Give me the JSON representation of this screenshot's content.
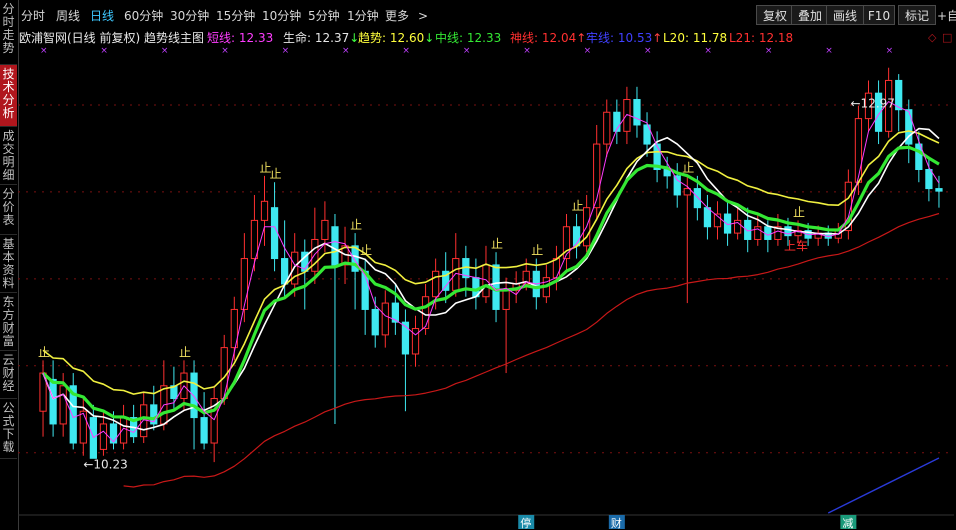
{
  "sidebar": {
    "tabs": [
      {
        "label": "分时走势",
        "active": false
      },
      {
        "label": "技术分析",
        "active": true
      },
      {
        "label": "成交明细",
        "active": false
      },
      {
        "label": "分价表",
        "active": false
      },
      {
        "label": "基本资料",
        "active": false
      },
      {
        "label": "东方财富",
        "active": false
      },
      {
        "label": "云财经",
        "active": false
      },
      {
        "label": "公式下载",
        "active": false
      }
    ]
  },
  "toolbar": {
    "periods": [
      "分时",
      "周线",
      "日线",
      "60分钟",
      "30分钟",
      "15分钟",
      "10分钟",
      "5分钟",
      "1分钟",
      "更多"
    ],
    "active_period": "日线",
    "more_arrow": ">",
    "buttons": [
      "复权",
      "叠加",
      "画线",
      "F10",
      "标记"
    ],
    "add_label": "+自"
  },
  "legend": {
    "title": "欧浦智网(日线 前复权) 趋势线主图",
    "items": [
      {
        "label": "短线: 12.33",
        "arrow": "",
        "color": "#ff3cff"
      },
      {
        "label": "生命: 12.37",
        "arrow": "↓",
        "color": "#e6e6e6"
      },
      {
        "label": "趋势: 12.60",
        "arrow": "↓",
        "color": "#ffff3c"
      },
      {
        "label": "中线: 12.33",
        "arrow": "",
        "color": "#34e834"
      },
      {
        "label": "神线: 12.04",
        "arrow": "↑",
        "color": "#ff3030"
      },
      {
        "label": "牢线: 10.53",
        "arrow": "↑",
        "color": "#4040ff"
      },
      {
        "label": "L20: 11.78",
        "arrow": "",
        "color": "#ffff3c"
      },
      {
        "label": "L21: 12.18",
        "arrow": "",
        "color": "#ff3030"
      }
    ]
  },
  "chart_data": {
    "type": "candlestick",
    "count": 90,
    "ylim": [
      9.8,
      13.4
    ],
    "candles": [
      [
        10.6,
        10.9,
        11.0,
        10.4
      ],
      [
        10.85,
        10.5,
        11.0,
        10.4
      ],
      [
        10.5,
        10.8,
        10.9,
        10.4
      ],
      [
        10.8,
        10.35,
        10.9,
        10.3
      ],
      [
        10.35,
        10.6,
        10.7,
        10.25
      ],
      [
        10.55,
        10.23,
        10.65,
        10.23
      ],
      [
        10.3,
        10.5,
        10.6,
        10.25
      ],
      [
        10.5,
        10.35,
        10.6,
        10.3
      ],
      [
        10.35,
        10.55,
        10.65,
        10.3
      ],
      [
        10.55,
        10.4,
        10.65,
        10.35
      ],
      [
        10.4,
        10.65,
        10.75,
        10.35
      ],
      [
        10.65,
        10.5,
        10.8,
        10.45
      ],
      [
        10.5,
        10.8,
        11.0,
        10.45
      ],
      [
        10.8,
        10.7,
        10.95,
        10.6
      ],
      [
        10.7,
        10.9,
        11.0,
        10.6
      ],
      [
        10.9,
        10.55,
        11.0,
        10.3
      ],
      [
        10.55,
        10.35,
        10.75,
        10.3
      ],
      [
        10.35,
        10.7,
        10.8,
        10.2
      ],
      [
        10.7,
        11.1,
        11.2,
        10.65
      ],
      [
        11.1,
        11.4,
        11.5,
        11.0
      ],
      [
        11.4,
        11.8,
        12.0,
        11.3
      ],
      [
        11.8,
        12.1,
        12.3,
        11.7
      ],
      [
        12.1,
        12.25,
        12.45,
        11.9
      ],
      [
        12.2,
        11.8,
        12.4,
        11.7
      ],
      [
        11.8,
        11.6,
        12.1,
        11.5
      ],
      [
        11.6,
        11.85,
        12.0,
        11.5
      ],
      [
        11.85,
        11.7,
        11.95,
        11.4
      ],
      [
        11.7,
        11.95,
        12.2,
        11.6
      ],
      [
        11.95,
        12.1,
        12.25,
        11.85
      ],
      [
        12.05,
        11.75,
        12.15,
        10.5
      ],
      [
        11.75,
        11.9,
        12.05,
        11.6
      ],
      [
        11.9,
        11.7,
        12.0,
        11.4
      ],
      [
        11.7,
        11.4,
        11.8,
        11.2
      ],
      [
        11.4,
        11.2,
        11.5,
        11.1
      ],
      [
        11.2,
        11.45,
        11.55,
        11.1
      ],
      [
        11.45,
        11.3,
        11.6,
        11.2
      ],
      [
        11.3,
        11.05,
        11.4,
        10.6
      ],
      [
        11.05,
        11.25,
        11.35,
        10.95
      ],
      [
        11.25,
        11.5,
        11.6,
        11.2
      ],
      [
        11.5,
        11.7,
        11.8,
        11.4
      ],
      [
        11.7,
        11.55,
        11.85,
        11.45
      ],
      [
        11.55,
        11.8,
        12.0,
        11.5
      ],
      [
        11.8,
        11.65,
        11.9,
        11.5
      ],
      [
        11.65,
        11.5,
        11.8,
        11.4
      ],
      [
        11.5,
        11.75,
        11.9,
        11.45
      ],
      [
        11.75,
        11.4,
        11.85,
        11.3
      ],
      [
        11.4,
        11.55,
        11.65,
        10.9
      ],
      [
        11.55,
        11.6,
        11.7,
        11.45
      ],
      [
        11.6,
        11.7,
        11.8,
        11.55
      ],
      [
        11.7,
        11.5,
        11.8,
        11.4
      ],
      [
        11.5,
        11.65,
        11.75,
        11.45
      ],
      [
        11.65,
        11.8,
        11.9,
        11.55
      ],
      [
        11.8,
        12.05,
        12.15,
        11.7
      ],
      [
        12.05,
        11.9,
        12.15,
        11.8
      ],
      [
        11.9,
        12.2,
        12.3,
        11.85
      ],
      [
        12.2,
        12.7,
        12.85,
        12.1
      ],
      [
        12.7,
        12.95,
        13.05,
        12.6
      ],
      [
        12.95,
        12.8,
        13.05,
        12.7
      ],
      [
        12.8,
        13.05,
        13.15,
        12.7
      ],
      [
        13.05,
        12.85,
        13.15,
        12.75
      ],
      [
        12.85,
        12.7,
        12.95,
        12.6
      ],
      [
        12.7,
        12.5,
        12.8,
        12.4
      ],
      [
        12.5,
        12.45,
        12.6,
        12.35
      ],
      [
        12.45,
        12.3,
        12.55,
        12.2
      ],
      [
        12.3,
        12.35,
        12.45,
        11.45
      ],
      [
        12.35,
        12.2,
        12.45,
        12.1
      ],
      [
        12.2,
        12.05,
        12.3,
        11.95
      ],
      [
        12.05,
        12.15,
        12.25,
        11.95
      ],
      [
        12.15,
        12.0,
        12.25,
        11.9
      ],
      [
        12.0,
        12.1,
        12.2,
        11.95
      ],
      [
        12.1,
        11.95,
        12.2,
        11.85
      ],
      [
        11.95,
        12.05,
        12.15,
        11.9
      ],
      [
        12.05,
        11.95,
        12.1,
        11.85
      ],
      [
        11.95,
        12.05,
        12.15,
        11.9
      ],
      [
        12.05,
        11.98,
        12.12,
        11.9
      ],
      [
        11.98,
        12.02,
        12.1,
        11.92
      ],
      [
        12.02,
        11.96,
        12.08,
        11.9
      ],
      [
        11.96,
        12.0,
        12.06,
        11.9
      ],
      [
        12.0,
        11.96,
        12.06,
        11.9
      ],
      [
        11.96,
        12.02,
        12.08,
        11.92
      ],
      [
        12.02,
        12.4,
        12.5,
        11.95
      ],
      [
        12.4,
        12.9,
        13.0,
        12.3
      ],
      [
        12.9,
        13.1,
        13.2,
        12.8
      ],
      [
        13.1,
        12.8,
        13.2,
        12.7
      ],
      [
        12.8,
        13.2,
        13.3,
        12.75
      ],
      [
        13.2,
        12.97,
        13.25,
        12.8
      ],
      [
        12.97,
        12.7,
        13.05,
        12.55
      ],
      [
        12.7,
        12.5,
        12.8,
        12.4
      ],
      [
        12.5,
        12.35,
        12.6,
        12.25
      ],
      [
        12.35,
        12.33,
        12.45,
        12.2
      ]
    ],
    "annotations": {
      "high_label": "12.97",
      "low_label": "10.23",
      "stop_label": "止",
      "board_label": "上车",
      "bottom_markers": [
        "停",
        "财",
        "减"
      ]
    }
  }
}
